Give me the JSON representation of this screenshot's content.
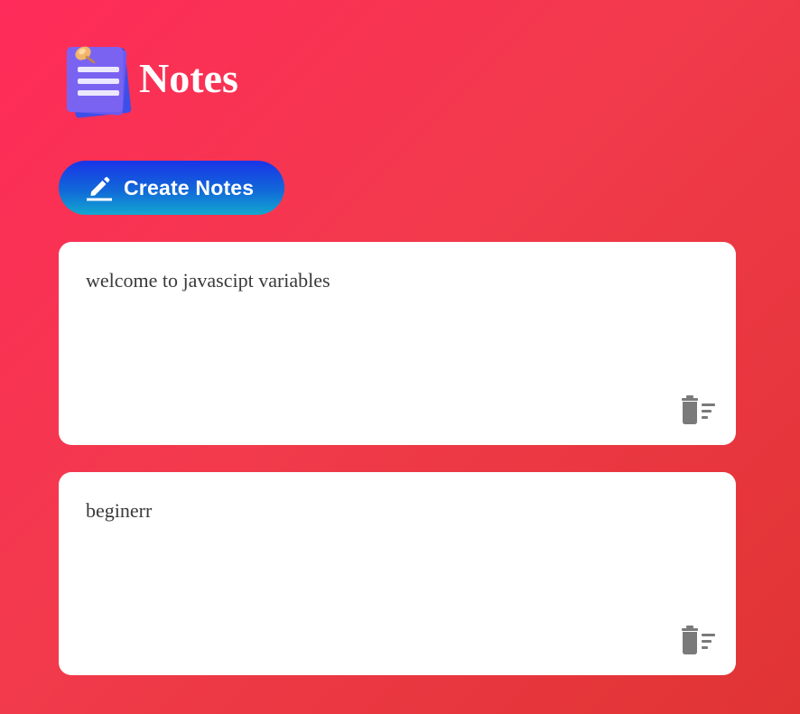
{
  "app": {
    "title": "Notes",
    "logo_icon": "notes-stack-icon"
  },
  "toolbar": {
    "create_label": "Create Notes",
    "create_icon": "pencil-icon"
  },
  "notes": [
    {
      "text": "welcome to javascipt variables",
      "delete_icon": "delete-sweep-icon"
    },
    {
      "text": "beginerr",
      "delete_icon": "delete-sweep-icon"
    }
  ],
  "colors": {
    "background_start": "#ff2b5a",
    "background_end": "#e03434",
    "button_top": "#1a34e8",
    "button_bottom": "#12a7d0",
    "card": "#ffffff",
    "icon_gray": "#7a7a7a"
  }
}
